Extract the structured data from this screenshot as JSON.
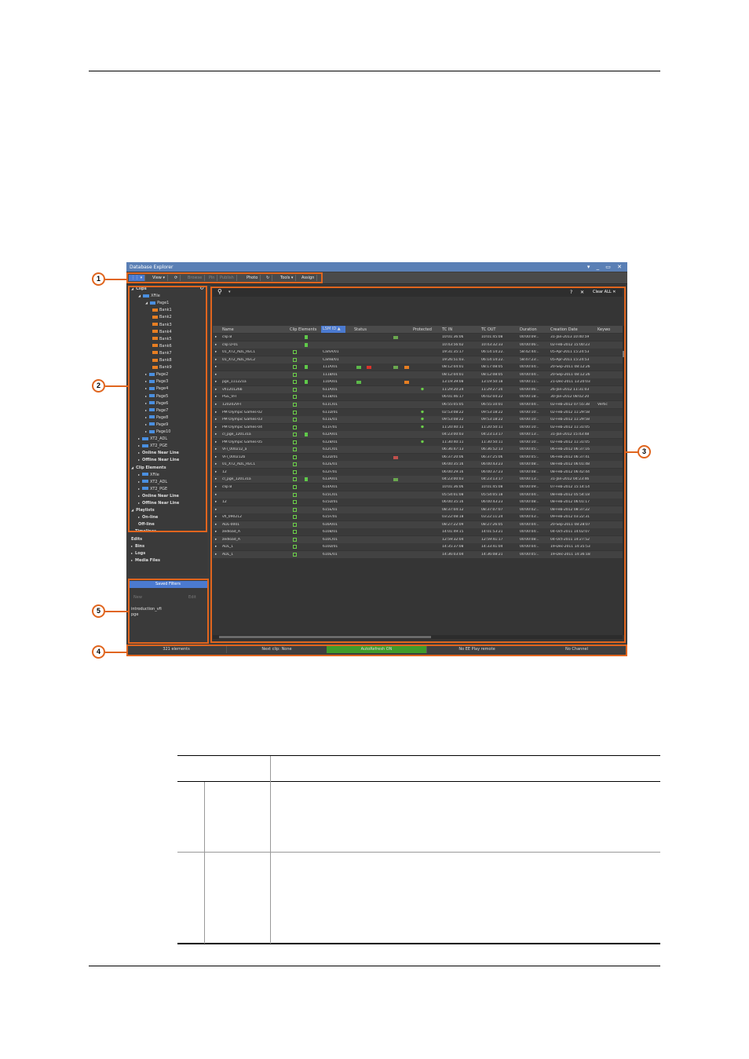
{
  "app": {
    "title": "Database Explorer",
    "window_controls": "▾ _ ▭ ✕"
  },
  "toolbar": {
    "items": [
      {
        "label": "⋮⋮ ▾",
        "state": "selected"
      },
      {
        "label": "View ▾",
        "state": "normal"
      },
      {
        "label": "⟳",
        "state": "normal"
      },
      {
        "label": "Browse",
        "state": "disabled"
      },
      {
        "label": "Pin",
        "state": "disabled"
      },
      {
        "label": "Publish",
        "state": "disabled"
      },
      {
        "label": "Photo",
        "state": "normal"
      },
      {
        "label": "↻",
        "state": "normal"
      },
      {
        "label": "Tools ▾",
        "state": "normal"
      },
      {
        "label": "Assign",
        "state": "normal"
      }
    ]
  },
  "tree": {
    "nodes": [
      {
        "label": "Clips",
        "level": 0,
        "bold": true,
        "arrow": "◢"
      },
      {
        "label": "XFile",
        "level": 1,
        "icon": "xt",
        "arrow": "◢"
      },
      {
        "label": "Page1",
        "level": 2,
        "icon": "blue",
        "arrow": "◢"
      },
      {
        "label": "Bank1",
        "level": 3,
        "icon": "orange"
      },
      {
        "label": "Bank2",
        "level": 3,
        "icon": "orange"
      },
      {
        "label": "Bank3",
        "level": 3,
        "icon": "orange"
      },
      {
        "label": "Bank4",
        "level": 3,
        "icon": "orange"
      },
      {
        "label": "Bank5",
        "level": 3,
        "icon": "orange"
      },
      {
        "label": "Bank6",
        "level": 3,
        "icon": "orange"
      },
      {
        "label": "Bank7",
        "level": 3,
        "icon": "orange"
      },
      {
        "label": "Bank8",
        "level": 3,
        "icon": "orange"
      },
      {
        "label": "Bank9",
        "level": 3,
        "icon": "orange"
      },
      {
        "label": "Page2",
        "level": 2,
        "icon": "blue",
        "arrow": "▸"
      },
      {
        "label": "Page3",
        "level": 2,
        "icon": "blue",
        "arrow": "▸"
      },
      {
        "label": "Page4",
        "level": 2,
        "icon": "blue",
        "arrow": "▸"
      },
      {
        "label": "Page5",
        "level": 2,
        "icon": "blue",
        "arrow": "▸"
      },
      {
        "label": "Page6",
        "level": 2,
        "icon": "blue",
        "arrow": "▸"
      },
      {
        "label": "Page7",
        "level": 2,
        "icon": "blue",
        "arrow": "▸"
      },
      {
        "label": "Page8",
        "level": 2,
        "icon": "blue",
        "arrow": "▸"
      },
      {
        "label": "Page9",
        "level": 2,
        "icon": "blue",
        "arrow": "▸"
      },
      {
        "label": "Page10",
        "level": 2,
        "icon": "blue",
        "arrow": "▸"
      },
      {
        "label": "XT2_ADL",
        "level": 1,
        "icon": "xt",
        "arrow": "▸"
      },
      {
        "label": "XT2_PGE",
        "level": 1,
        "icon": "xt",
        "arrow": "▸"
      },
      {
        "label": "Online Near Line",
        "level": 1,
        "bold": true,
        "arrow": "▸"
      },
      {
        "label": "Offline Near Line",
        "level": 1,
        "bold": true,
        "arrow": "▸"
      },
      {
        "label": "Clip Elements",
        "level": 0,
        "bold": true,
        "arrow": "◢"
      },
      {
        "label": "XFile",
        "level": 1,
        "icon": "xt",
        "arrow": "▸"
      },
      {
        "label": "XT2_ADL",
        "level": 1,
        "icon": "xt",
        "arrow": "▸"
      },
      {
        "label": "XT2_PGE",
        "level": 1,
        "icon": "xt",
        "arrow": "▸"
      },
      {
        "label": "Online Near Line",
        "level": 1,
        "bold": true,
        "arrow": "▸"
      },
      {
        "label": "Offline Near Line",
        "level": 1,
        "bold": true,
        "arrow": "▸"
      },
      {
        "label": "Playlists",
        "level": 0,
        "bold": true,
        "arrow": "◢"
      },
      {
        "label": "On-line",
        "level": 1,
        "bold": true,
        "arrow": "▸"
      },
      {
        "label": "Off-line",
        "level": 1,
        "bold": true
      },
      {
        "label": "Timelines",
        "level": 0,
        "bold": true,
        "arrow": "▸"
      },
      {
        "label": "Edits",
        "level": 0,
        "bold": true
      },
      {
        "label": "Bins",
        "level": 0,
        "bold": true,
        "arrow": "▸"
      },
      {
        "label": "Logs",
        "level": 0,
        "bold": true,
        "arrow": "▸"
      },
      {
        "label": "Media Files",
        "level": 0,
        "bold": true,
        "arrow": "▸"
      }
    ]
  },
  "saved_filters": {
    "title": "Saved Filters",
    "new_label": "New",
    "edit_label": "Edit",
    "items": [
      "introduction_vfi",
      "pge"
    ]
  },
  "grid": {
    "search_placeholder": "",
    "help": "?",
    "clear": "✕",
    "clear_all": "Clear ALL ✕",
    "columns": [
      "Name",
      "Clip Elements",
      "LSM ID ▲",
      "Status",
      "Protected",
      "TC IN",
      "TC OUT",
      "Duration",
      "Creation Date",
      "Keywo"
    ],
    "rows": [
      {
        "name": "clip B",
        "ce": false,
        "doc": true,
        "lsm": "",
        "status": [
          "vid"
        ],
        "prot": false,
        "tcin": "10:01:36:06",
        "tcout": "10:01:45:08",
        "dur": "00:00:09:..",
        "date": "31-Jan-2013 10:40:59",
        "kw": ""
      },
      {
        "name": "clip D-01",
        "ce": false,
        "doc": true,
        "lsm": "",
        "status": [],
        "prot": false,
        "tcin": "10:43:56:02",
        "tcout": "10:43:32:33",
        "dur": "00:00:06:..",
        "date": "02-Feb-2012 15:00:23",
        "kw": ""
      },
      {
        "name": "01_XT2_ADL_REC1",
        "ce": true,
        "doc": false,
        "lsm": "CamA/01",
        "status": [],
        "prot": false,
        "tcin": "19:31:35:17",
        "tcout": "06:14:14:22.",
        "dur": "58:42:44:..",
        "date": "05-Apr-2011 15:24:53",
        "kw": ""
      },
      {
        "name": "01_XT2_ADL_REC2",
        "ce": true,
        "doc": false,
        "lsm": "CamB/01",
        "status": [],
        "prot": false,
        "tcin": "19:26:51:03.",
        "tcout": "06:14:14:22.",
        "dur": "58:47:23:..",
        "date": "05-Apr-2011 15:24:53",
        "kw": ""
      },
      {
        "name": "",
        "ce": true,
        "doc": true,
        "lsm": "111A/01",
        "status": [
          "green",
          "red",
          "vid",
          "orange"
        ],
        "prot": false,
        "tcin": "08:12:04:01",
        "tcout": "08:17:08:05",
        "dur": "00:00:04:..",
        "date": "20-Sep-2011 08:12:26",
        "kw": ""
      },
      {
        "name": "",
        "ce": true,
        "doc": false,
        "lsm": "111B/01",
        "status": [],
        "prot": false,
        "tcin": "08:12:04:01",
        "tcout": "08:12:08:05",
        "dur": "00:00:04:..",
        "date": "20-Sep-2011 08:12:26",
        "kw": ""
      },
      {
        "name": "pge_111221a",
        "ce": true,
        "doc": true,
        "lsm": "110A/01",
        "status": [
          "green",
          "orange"
        ],
        "prot": false,
        "tcin": "13:19:39:08",
        "tcout": "13:19:50:18",
        "dur": "00:00:11:..",
        "date": "21-Dec-2011 13:20:03",
        "kw": ""
      },
      {
        "name": "vfi120126b",
        "ce": true,
        "doc": false,
        "lsm": "611A/01",
        "status": [],
        "prot": true,
        "tcin": "11:29:20:24",
        "tcout": "11:29:27:20",
        "dur": "00:00:06:..",
        "date": "26-Jan-2012 11:31:03",
        "kw": ""
      },
      {
        "name": "PGE_VFI",
        "ce": true,
        "doc": false,
        "lsm": "611B/01",
        "status": [],
        "prot": false,
        "tcin": "06:01:46:17",
        "tcout": "06:02:04:22",
        "dur": "00:00:18:..",
        "date": "30-Jan-2012 08:02:20",
        "kw": ""
      },
      {
        "name": "120202VFI",
        "ce": true,
        "doc": false,
        "lsm": "611C/01",
        "status": [],
        "prot": false,
        "tcin": "06:55:05:05",
        "tcout": "06:55:10:01",
        "dur": "00:00:04:..",
        "date": "02-Feb-2012 07:55:38",
        "kw": "Vertic"
      },
      {
        "name": "PM Olympic Games-02",
        "ce": true,
        "doc": false,
        "lsm": "611D/01",
        "status": [],
        "prot": true,
        "tcin": "02:53:08:22",
        "tcout": "09:53:18:22",
        "dur": "00:00:10:..",
        "date": "02-Feb-2012 11:29:58",
        "kw": ""
      },
      {
        "name": "PM Olympic Games-03",
        "ce": true,
        "doc": false,
        "lsm": "611E/01",
        "status": [],
        "prot": true,
        "tcin": "09:53:08:22",
        "tcout": "09:53:18:22",
        "dur": "00:00:10:..",
        "date": "02-Feb-2012 11:29:58",
        "kw": ""
      },
      {
        "name": "PM Olympic Games-04",
        "ce": true,
        "doc": false,
        "lsm": "611F/01",
        "status": [],
        "prot": true,
        "tcin": "11:20:40:11",
        "tcout": "11:20:50:11",
        "dur": "00:00:10:..",
        "date": "02-Feb-2012 11:31:05",
        "kw": ""
      },
      {
        "name": "cl_pge_120131a",
        "ce": true,
        "doc": true,
        "lsm": "612A/01",
        "status": [],
        "prot": false,
        "tcin": "04:23:00:03",
        "tcout": "04:23:13:17",
        "dur": "00:00:13:..",
        "date": "31-Jan-2012 15:43:48",
        "kw": ""
      },
      {
        "name": "PM Olympic Games-05",
        "ce": true,
        "doc": false,
        "lsm": "612B/01",
        "status": [],
        "prot": true,
        "tcin": "11:30:40:11",
        "tcout": "11:30:50:11",
        "dur": "00:00:10:..",
        "date": "02-Feb-2012 11:31:05",
        "kw": ""
      },
      {
        "name": "VFI_000212_a",
        "ce": true,
        "doc": false,
        "lsm": "612C/01",
        "status": [],
        "prot": false,
        "tcin": "06:36:47:13",
        "tcout": "06:36:52:13",
        "dur": "00:00:05:..",
        "date": "06-Feb-2012 06:37:16",
        "kw": ""
      },
      {
        "name": "VFI_000212b",
        "ce": true,
        "doc": false,
        "lsm": "612D/01",
        "status": [
          "redsmall"
        ],
        "prot": false,
        "tcin": "06:37:20:06",
        "tcout": "06:37:25:06",
        "dur": "00:00:05:..",
        "date": "06-Feb-2012 06:37:41",
        "kw": ""
      },
      {
        "name": "01_XT2_ADL_REC1",
        "ce": true,
        "doc": false,
        "lsm": "612E/01",
        "status": [],
        "prot": false,
        "tcin": "06:00:35:16",
        "tcout": "06:00:43:23",
        "dur": "00:00:08:..",
        "date": "08-Feb-2012 06:01:48",
        "kw": ""
      },
      {
        "name": "12",
        "ce": true,
        "doc": false,
        "lsm": "612F/01",
        "status": [],
        "prot": false,
        "tcin": "06:00:29:16",
        "tcout": "06:00:37:23",
        "dur": "00:00:08:..",
        "date": "08-Feb-2012 06:42:44",
        "kw": ""
      },
      {
        "name": "cl_pge_120131a",
        "ce": true,
        "doc": true,
        "lsm": "613A/01",
        "status": [
          "vid"
        ],
        "prot": false,
        "tcin": "04:23:00:03",
        "tcout": "04:23:13:17",
        "dur": "00:00:13:..",
        "date": "31-Jan-2012 04:23:46",
        "kw": ""
      },
      {
        "name": "clip B",
        "ce": true,
        "doc": false,
        "lsm": "614A/01",
        "status": [],
        "prot": false,
        "tcin": "10:01:36:06",
        "tcout": "10:01:45:08",
        "dur": "00:00:09:..",
        "date": "07-Feb-2012 15:14:14",
        "kw": ""
      },
      {
        "name": "",
        "ce": true,
        "doc": false,
        "lsm": "615C/01",
        "status": [],
        "prot": false,
        "tcin": "05:54:01:08",
        "tcout": "05:54:05:18",
        "dur": "00:00:04:..",
        "date": "08-Feb-2012 05:54:18",
        "kw": ""
      },
      {
        "name": "12",
        "ce": true,
        "doc": false,
        "lsm": "615D/01",
        "status": [],
        "prot": false,
        "tcin": "06:00:35:16",
        "tcout": "06:00:43:23",
        "dur": "00:00:08:..",
        "date": "08-Feb-2012 06:01:17",
        "kw": ""
      },
      {
        "name": "",
        "ce": true,
        "doc": false,
        "lsm": "615E/01",
        "status": [],
        "prot": false,
        "tcin": "08:37:04:12",
        "tcout": "08:37:07:07",
        "dur": "00:00:02:..",
        "date": "08-Feb-2012 08:37:22",
        "kw": ""
      },
      {
        "name": "vfi_090212",
        "ce": true,
        "doc": false,
        "lsm": "615F/01",
        "status": [],
        "prot": false,
        "tcin": "03:22:08:18",
        "tcout": "03:22:11:24",
        "dur": "00:00:03:..",
        "date": "09-Feb-2012 03:22:31",
        "kw": ""
      },
      {
        "name": "ADL-0001",
        "ce": true,
        "doc": false,
        "lsm": "616A/01",
        "status": [],
        "prot": false,
        "tcin": "08:27:22:09",
        "tcout": "08:27:26:05",
        "dur": "00:00:04:..",
        "date": "20-Sep-2011 08:28:07",
        "kw": ""
      },
      {
        "name": "zedload_A",
        "ce": true,
        "doc": false,
        "lsm": "610B/01",
        "status": [],
        "prot": false,
        "tcin": "14:01:49:15",
        "tcout": "14:01:53:21",
        "dur": "00:00:04:..",
        "date": "04-Oct-2011 14:02:07",
        "kw": ""
      },
      {
        "name": "zedload_A",
        "ce": true,
        "doc": false,
        "lsm": "610C/01",
        "status": [],
        "prot": false,
        "tcin": "12:59:32:04",
        "tcout": "12:59:41:17",
        "dur": "00:00:08:..",
        "date": "04-Oct-2011 14:27:52",
        "kw": ""
      },
      {
        "name": "ADL_1",
        "ce": true,
        "doc": false,
        "lsm": "610D/01",
        "status": [],
        "prot": false,
        "tcin": "14:35:37:08",
        "tcout": "14:33:41:04",
        "dur": "00:00:04:..",
        "date": "19-Dec-2011 14:35:53",
        "kw": ""
      },
      {
        "name": "ADL_1",
        "ce": true,
        "doc": false,
        "lsm": "610E/01",
        "status": [],
        "prot": false,
        "tcin": "14:36:03:04",
        "tcout": "14:36:08:21",
        "dur": "00:00:05:..",
        "date": "19-Dec-2011 14:36:18",
        "kw": ""
      }
    ]
  },
  "statusbar": {
    "cells": [
      {
        "label": "321 elements",
        "color": "#3f3f3f"
      },
      {
        "label": "Next clip: None",
        "color": "#3f3f3f"
      },
      {
        "label": "AutoRefresh ON",
        "color": "#3f9b2a"
      },
      {
        "label": "No EE Play remote",
        "color": "#3f3f3f"
      },
      {
        "label": "No Channel",
        "color": "#3f3f3f"
      }
    ]
  },
  "callouts": [
    "1",
    "2",
    "3",
    "4",
    "5"
  ],
  "colors": {
    "callout": "#e0651e",
    "titlebar": "#5a7fb5",
    "selection": "#4b7ad0",
    "status_on": "#3f9b2a"
  }
}
